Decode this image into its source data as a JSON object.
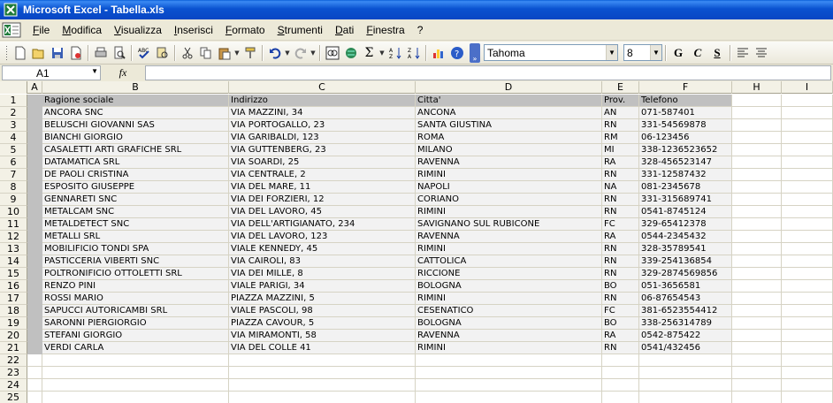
{
  "window": {
    "title": "Microsoft Excel - Tabella.xls"
  },
  "menu": [
    "File",
    "Modifica",
    "Visualizza",
    "Inserisci",
    "Formato",
    "Strumenti",
    "Dati",
    "Finestra",
    "?"
  ],
  "toolbar": {
    "icons": [
      "new-icon",
      "open-icon",
      "save-icon",
      "permission-icon",
      "print-icon",
      "print-preview-icon",
      "spelling-icon",
      "research-icon",
      "cut-icon",
      "copy-icon",
      "paste-icon",
      "format-painter-icon",
      "undo-icon",
      "redo-icon",
      "hyperlink-icon",
      "web-icon",
      "autosum-icon",
      "sort-ascending-icon",
      "sort-descending-icon",
      "chart-wizard-icon",
      "help-icon"
    ],
    "font_name": "Tahoma",
    "font_size": "8",
    "bold_label": "G",
    "italic_label": "C",
    "underline_label": "S"
  },
  "formula_bar": {
    "name_box": "A1",
    "fx_label": "fx",
    "value": ""
  },
  "columns": [
    "A",
    "B",
    "C",
    "D",
    "E",
    "F",
    "H",
    "I"
  ],
  "header_row": [
    "",
    "Ragione sociale",
    "Indirizzo",
    "Citta'",
    "Prov.",
    "Telefono",
    "",
    ""
  ],
  "rows": [
    [
      "",
      "ANCORA SNC",
      "VIA MAZZINI, 34",
      "ANCONA",
      "AN",
      "071-587401"
    ],
    [
      "",
      "BELUSCHI GIOVANNI SAS",
      "VIA PORTOGALLO, 23",
      "SANTA GIUSTINA",
      "RN",
      "331-54569878"
    ],
    [
      "",
      "BIANCHI GIORGIO",
      "VIA GARIBALDI, 123",
      "ROMA",
      "RM",
      "06-123456"
    ],
    [
      "",
      "CASALETTI ARTI GRAFICHE SRL",
      "VIA GUTTENBERG, 23",
      "MILANO",
      "MI",
      "338-1236523652"
    ],
    [
      "",
      "DATAMATICA SRL",
      "VIA SOARDI, 25",
      "RAVENNA",
      "RA",
      "328-456523147"
    ],
    [
      "",
      "DE PAOLI CRISTINA",
      "VIA CENTRALE, 2",
      "RIMINI",
      "RN",
      "331-12587432"
    ],
    [
      "",
      "ESPOSITO GIUSEPPE",
      "VIA DEL MARE, 11",
      "NAPOLI",
      "NA",
      "081-2345678"
    ],
    [
      "",
      "GENNARETI SNC",
      "VIA DEI FORZIERI, 12",
      "CORIANO",
      "RN",
      "331-315689741"
    ],
    [
      "",
      "METALCAM SNC",
      "VIA DEL LAVORO, 45",
      "RIMINI",
      "RN",
      "0541-8745124"
    ],
    [
      "",
      "METALDETECT SNC",
      "VIA DELL'ARTIGIANATO, 234",
      "SAVIGNANO SUL RUBICONE",
      "FC",
      "329-65412378"
    ],
    [
      "",
      "METALLI SRL",
      "VIA DEL LAVORO, 123",
      "RAVENNA",
      "RA",
      "0544-2345432"
    ],
    [
      "",
      "MOBILIFICIO TONDI SPA",
      "VIALE KENNEDY, 45",
      "RIMINI",
      "RN",
      "328-35789541"
    ],
    [
      "",
      "PASTICCERIA VIBERTI SNC",
      "VIA CAIROLI, 83",
      "CATTOLICA",
      "RN",
      "339-254136854"
    ],
    [
      "",
      "POLTRONIFICIO OTTOLETTI SRL",
      "VIA DEI MILLE, 8",
      "RICCIONE",
      "RN",
      "329-2874569856"
    ],
    [
      "",
      "RENZO PINI",
      "VIALE PARIGI, 34",
      "BOLOGNA",
      "BO",
      "051-3656581"
    ],
    [
      "",
      "ROSSI MARIO",
      "PIAZZA MAZZINI, 5",
      "RIMINI",
      "RN",
      "06-87654543"
    ],
    [
      "",
      "SAPUCCI AUTORICAMBI SRL",
      "VIALE PASCOLI, 98",
      "CESENATICO",
      "FC",
      "381-6523554412"
    ],
    [
      "",
      "SARONNI PIERGIORGIO",
      "PIAZZA CAVOUR, 5",
      "BOLOGNA",
      "BO",
      "338-256314789"
    ],
    [
      "",
      "STEFANI GIORGIO",
      "VIA MIRAMONTI, 58",
      "RAVENNA",
      "RA",
      "0542-875422"
    ],
    [
      "",
      "VERDI CARLA",
      "VIA DEL COLLE 41",
      "RIMINI",
      "RN",
      "0541/432456"
    ]
  ],
  "empty_row_numbers": [
    "22",
    "23",
    "24",
    "25"
  ]
}
